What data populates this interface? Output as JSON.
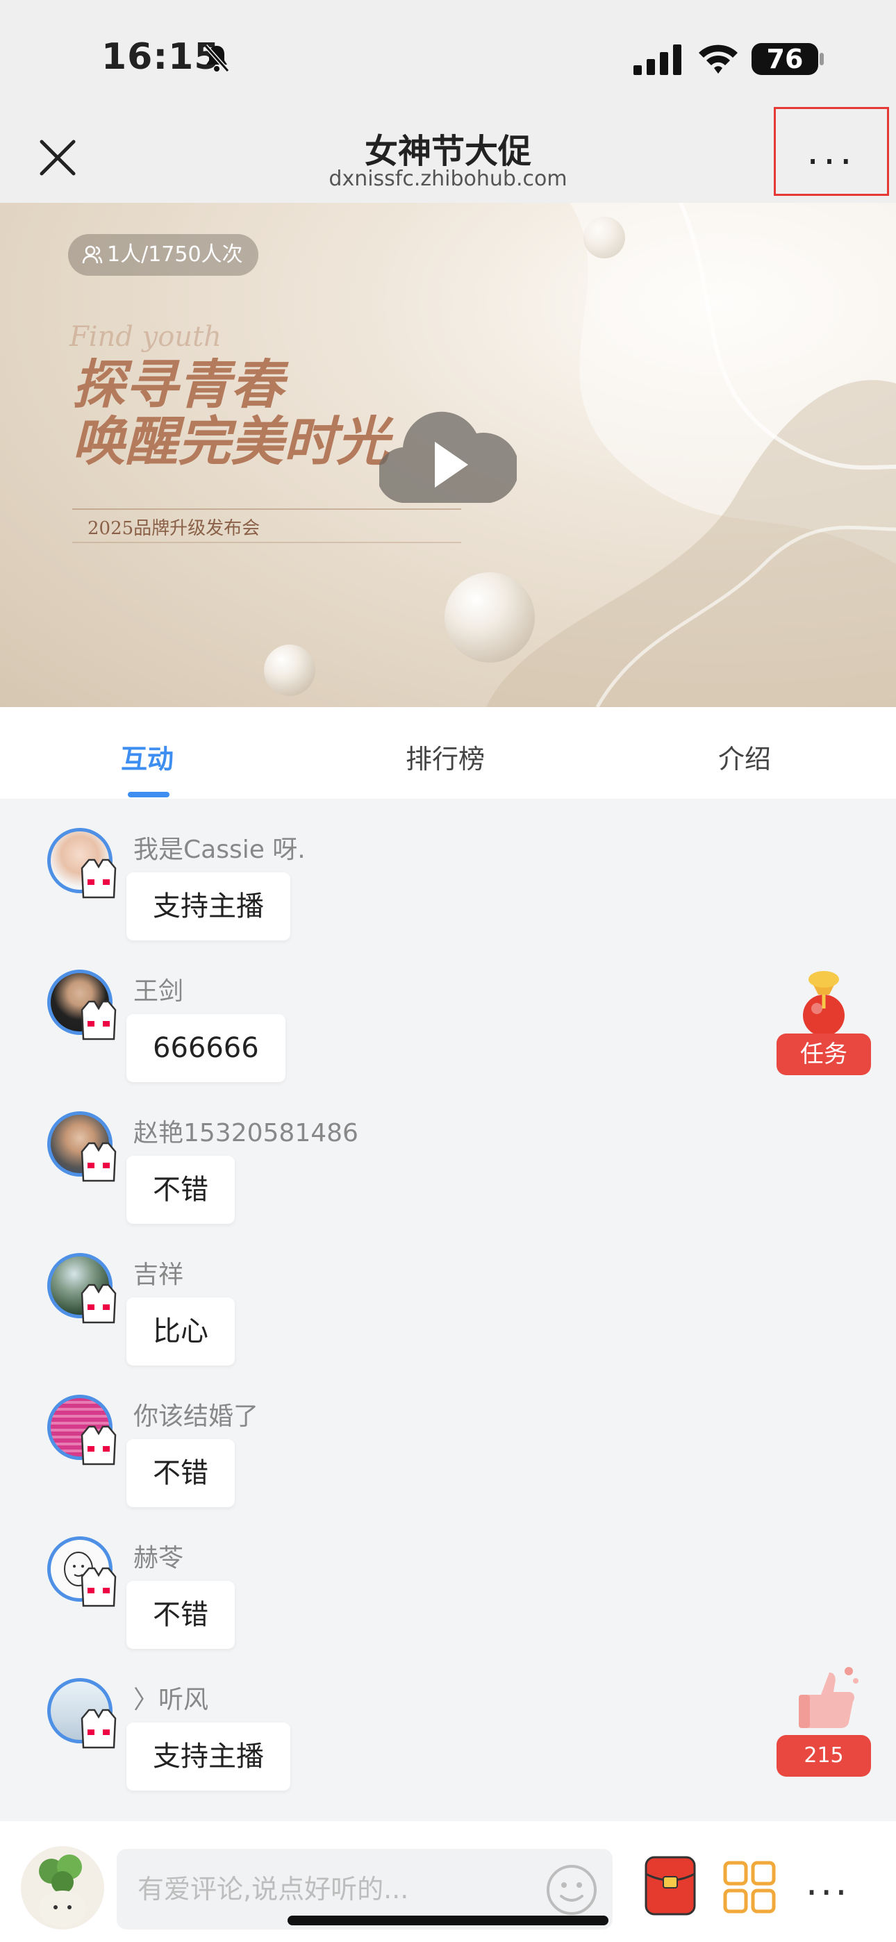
{
  "status_bar": {
    "time": "16:15",
    "battery": "76",
    "icons": [
      "bell-muted-icon",
      "signal-icon",
      "wifi-icon",
      "battery-icon"
    ]
  },
  "nav": {
    "title": "女神节大促",
    "subtitle": "dxnissfc.zhibohub.com",
    "close_icon": "close-icon",
    "more_icon": "more-dots-icon",
    "more_label": "..."
  },
  "poster": {
    "viewers": "1人/1750人次",
    "script_text": "Find youth",
    "headline_line1": "探寻青春",
    "headline_line2": "唤醒完美时光",
    "event_subtitle": "2025品牌升级发布会",
    "play_icon": "play-icon"
  },
  "tabs": [
    {
      "label": "互动",
      "active": true
    },
    {
      "label": "排行榜",
      "active": false
    },
    {
      "label": "介绍",
      "active": false
    }
  ],
  "messages": [
    {
      "name": "我是Cassie 呀.",
      "text": "支持主播"
    },
    {
      "name": "王剑",
      "text": "666666"
    },
    {
      "name": "赵艳15320581486",
      "text": "不错"
    },
    {
      "name": "吉祥",
      "text": "比心"
    },
    {
      "name": "你该结婚了",
      "text": "不错"
    },
    {
      "name": "赫苓",
      "text": "不错"
    },
    {
      "name": "〉听风",
      "text": "支持主播"
    }
  ],
  "widgets": {
    "task": {
      "label": "任务",
      "icon": "lucky-bag-icon"
    },
    "like": {
      "count": "215",
      "icon": "thumbs-up-icon"
    }
  },
  "bottom_bar": {
    "comment_placeholder": "有爱评论,说点好听的...",
    "icons": [
      "emoji-icon",
      "red-packet-icon",
      "grid-menu-icon",
      "more-dots-icon"
    ],
    "more_label": "..."
  },
  "colors": {
    "accent": "#3d8ef0",
    "badge_red": "#e8483f",
    "highlight_box": "#e53935"
  }
}
